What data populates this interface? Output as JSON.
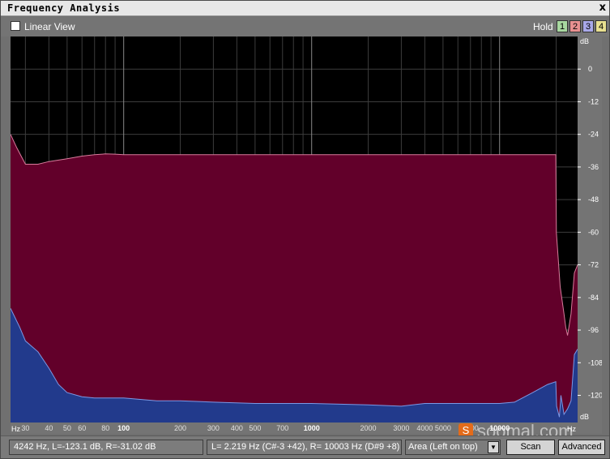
{
  "window": {
    "title": "Frequency Analysis",
    "close_glyph": "x"
  },
  "toolbar": {
    "linear_view_label": "Linear View",
    "linear_view_checked": false,
    "hold_label": "Hold",
    "hold_buttons": [
      {
        "label": "1",
        "color": "#a8d8a0"
      },
      {
        "label": "2",
        "color": "#e89090"
      },
      {
        "label": "3",
        "color": "#a8a8e8"
      },
      {
        "label": "4",
        "color": "#e8e090"
      }
    ]
  },
  "status": {
    "cursor_readout": "4242 Hz, L=-123.1 dB, R=-31.02 dB",
    "peak_readout": "L=  2.219 Hz (C#-3 +42), R=  10003 Hz (D#9 +8)",
    "display_mode": "Area (Left on top)",
    "scan_label": "Scan",
    "advanced_label": "Advanced"
  },
  "watermark": {
    "text": "soomal.com",
    "logo_glyph": "S"
  },
  "chart_data": {
    "type": "area",
    "x_scale": "log",
    "xlim": [
      25,
      26000
    ],
    "ylim": [
      -130,
      12
    ],
    "x_unit_label": "Hz",
    "y_unit_label": "dB",
    "x_major_ticks": [
      100,
      1000,
      10000
    ],
    "x_minor_ticks": [
      30,
      40,
      50,
      60,
      70,
      80,
      90,
      200,
      300,
      400,
      500,
      600,
      700,
      800,
      900,
      2000,
      3000,
      4000,
      5000,
      6000,
      7000,
      8000,
      9000,
      20000
    ],
    "x_tick_labels": [
      {
        "value": 30,
        "label": "30"
      },
      {
        "value": 40,
        "label": "40"
      },
      {
        "value": 50,
        "label": "50"
      },
      {
        "value": 60,
        "label": "60"
      },
      {
        "value": 80,
        "label": "80"
      },
      {
        "value": 100,
        "label": "100"
      },
      {
        "value": 200,
        "label": "200"
      },
      {
        "value": 300,
        "label": "300"
      },
      {
        "value": 400,
        "label": "400"
      },
      {
        "value": 500,
        "label": "500"
      },
      {
        "value": 700,
        "label": "700"
      },
      {
        "value": 1000,
        "label": "1000"
      },
      {
        "value": 2000,
        "label": "2000"
      },
      {
        "value": 3000,
        "label": "3000"
      },
      {
        "value": 4000,
        "label": "4000"
      },
      {
        "value": 5000,
        "label": "5000"
      },
      {
        "value": 7000,
        "label": "7000"
      },
      {
        "value": 10000,
        "label": "10000"
      }
    ],
    "y_ticks": [
      0,
      -12,
      -24,
      -36,
      -48,
      -60,
      -72,
      -84,
      -96,
      -108,
      -120
    ],
    "grid": true,
    "colors": {
      "background": "#000000",
      "grid": "#3c3c3c",
      "right_channel_fill": "#62002a",
      "right_channel_line": "#d87c9c",
      "left_channel_fill": "#223a8c",
      "left_channel_line": "#7c98e4"
    },
    "series": [
      {
        "channel": "right",
        "x": [
          25,
          27,
          30,
          35,
          40,
          50,
          60,
          70,
          80,
          90,
          100,
          200,
          500,
          1000,
          2000,
          5000,
          10000,
          15000,
          19900,
          20050,
          21000,
          22000,
          22500,
          23000,
          24000,
          25000,
          26000
        ],
        "y": [
          -24,
          -29,
          -35,
          -35,
          -34,
          -33,
          -32,
          -31.5,
          -31.2,
          -31.3,
          -31.5,
          -31.5,
          -31.5,
          -31.5,
          -31.5,
          -31.5,
          -31.5,
          -31.5,
          -31.5,
          -60,
          -80,
          -90,
          -95,
          -98,
          -90,
          -75,
          -72
        ]
      },
      {
        "channel": "left",
        "x": [
          25,
          28,
          30,
          35,
          40,
          45,
          50,
          60,
          70,
          80,
          100,
          150,
          200,
          300,
          500,
          700,
          1000,
          2000,
          3000,
          4000,
          5000,
          6000,
          7000,
          8000,
          10000,
          12000,
          15000,
          18000,
          19900,
          20100,
          20800,
          21200,
          22000,
          23000,
          24000,
          25000,
          26000
        ],
        "y": [
          -88,
          -95,
          -100,
          -104,
          -110,
          -116,
          -119,
          -120.5,
          -121,
          -121,
          -121,
          -122,
          -122,
          -122.5,
          -123,
          -123,
          -123,
          -123.5,
          -124,
          -123,
          -123,
          -123,
          -123,
          -123,
          -123,
          -122.5,
          -119,
          -116,
          -115,
          -124,
          -128,
          -120,
          -127,
          -125,
          -122,
          -105,
          -103
        ]
      }
    ]
  }
}
